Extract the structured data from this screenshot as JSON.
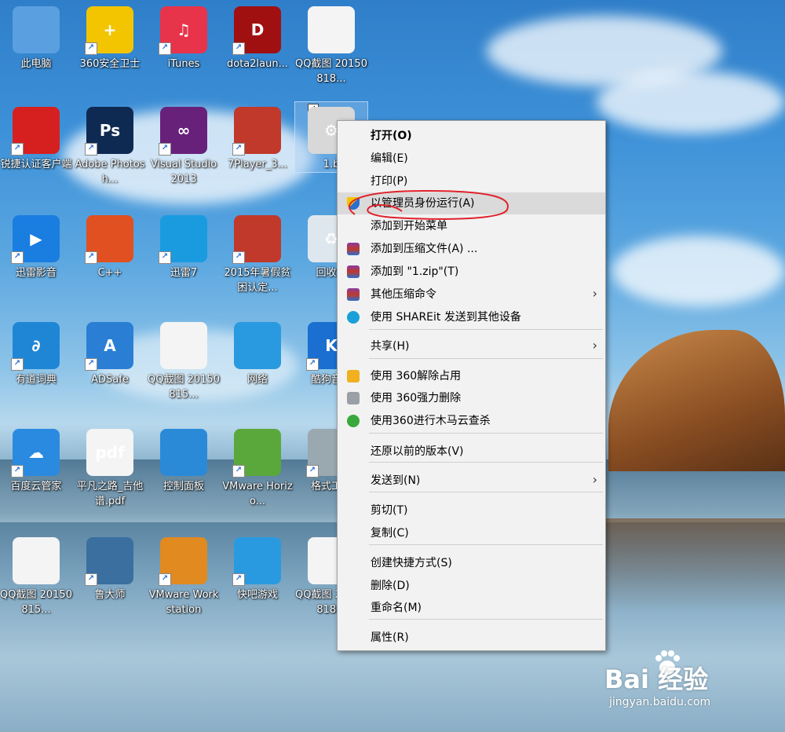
{
  "desktop": {
    "icons": [
      {
        "label": "此电脑",
        "symbol": "",
        "color": "#5aa0e0"
      },
      {
        "label": "360安全卫士",
        "symbol": "+",
        "color": "#f2c500"
      },
      {
        "label": "iTunes",
        "symbol": "♫",
        "color": "#e8344a"
      },
      {
        "label": "dota2laun...",
        "symbol": "D",
        "color": "#a01010"
      },
      {
        "label": "QQ截图 20150818...",
        "symbol": "",
        "color": "#f4f4f4"
      },
      {
        "label": "锐捷认证客户端",
        "symbol": "",
        "color": "#d62020"
      },
      {
        "label": "Adobe Photosh...",
        "symbol": "Ps",
        "color": "#0f2a52"
      },
      {
        "label": "Visual Studio 2013",
        "symbol": "∞",
        "color": "#68217a"
      },
      {
        "label": "7Player_3...",
        "symbol": "",
        "color": "#c0392b"
      },
      {
        "label": "1.b",
        "symbol": "⚙",
        "color": "#d8d8d8"
      },
      {
        "label": "迅雷影音",
        "symbol": "▶",
        "color": "#1a7de0"
      },
      {
        "label": "C++",
        "symbol": "",
        "color": "#e05020"
      },
      {
        "label": "迅雷7",
        "symbol": "",
        "color": "#1a9be0"
      },
      {
        "label": "2015年暑假贫困认定...",
        "symbol": "",
        "color": "#c0392b"
      },
      {
        "label": "回收站",
        "symbol": "♻",
        "color": "#dfe7ee"
      },
      {
        "label": "有道词典",
        "symbol": "∂",
        "color": "#1f86d6"
      },
      {
        "label": "ADSafe",
        "symbol": "A",
        "color": "#2a7fd4"
      },
      {
        "label": "QQ截图 20150815...",
        "symbol": "",
        "color": "#f4f4f4"
      },
      {
        "label": "网络",
        "symbol": "",
        "color": "#2a9ae0"
      },
      {
        "label": "酷狗音乐",
        "symbol": "K",
        "color": "#1a6fd0"
      },
      {
        "label": "百度云管家",
        "symbol": "☁",
        "color": "#2a8ae0"
      },
      {
        "label": "平凡之路_吉他谱.pdf",
        "symbol": "pdf",
        "color": "#f4f4f4"
      },
      {
        "label": "控制面板",
        "symbol": "",
        "color": "#2a8ad8"
      },
      {
        "label": "VMware Horizo...",
        "symbol": "",
        "color": "#5aa83c"
      },
      {
        "label": "格式工厂",
        "symbol": "",
        "color": "#9aa8b0"
      },
      {
        "label": "QQ截图 20150815...",
        "symbol": "",
        "color": "#f4f4f4"
      },
      {
        "label": "鲁大师",
        "symbol": "",
        "color": "#3a6fa0"
      },
      {
        "label": "VMware Workstation",
        "symbol": "",
        "color": "#e08a20"
      },
      {
        "label": "快吧游戏",
        "symbol": "",
        "color": "#2a9ae0"
      },
      {
        "label": "QQ截图 20150818...",
        "symbol": "",
        "color": "#f4f4f4"
      }
    ]
  },
  "context_menu": {
    "items": [
      {
        "label": "打开(O)",
        "icon": "",
        "submenu": false,
        "bold": true
      },
      {
        "label": "编辑(E)",
        "icon": "",
        "submenu": false
      },
      {
        "label": "打印(P)",
        "icon": "",
        "submenu": false
      },
      {
        "label": "以管理员身份运行(A)",
        "icon": "uac-shield-icon",
        "submenu": false,
        "highlighted": true
      },
      {
        "label": "添加到开始菜单",
        "icon": "",
        "submenu": false
      },
      {
        "label": "添加到压缩文件(A) ...",
        "icon": "winrar-icon",
        "submenu": false
      },
      {
        "label": "添加到 \"1.zip\"(T)",
        "icon": "winrar-icon",
        "submenu": false
      },
      {
        "label": "其他压缩命令",
        "icon": "winrar-icon",
        "submenu": true
      },
      {
        "label": "使用 SHAREit 发送到其他设备",
        "icon": "shareit-icon",
        "submenu": false
      },
      {
        "label": "共享(H)",
        "icon": "",
        "submenu": true
      },
      {
        "label": "使用 360解除占用",
        "icon": "unlock-360-icon",
        "submenu": false
      },
      {
        "label": "使用 360强力删除",
        "icon": "shred-360-icon",
        "submenu": false
      },
      {
        "label": "使用360进行木马云查杀",
        "icon": "scan-360-icon",
        "submenu": false
      },
      {
        "label": "还原以前的版本(V)",
        "icon": "",
        "submenu": false
      },
      {
        "label": "发送到(N)",
        "icon": "",
        "submenu": true
      },
      {
        "label": "剪切(T)",
        "icon": "",
        "submenu": false
      },
      {
        "label": "复制(C)",
        "icon": "",
        "submenu": false
      },
      {
        "label": "创建快捷方式(S)",
        "icon": "",
        "submenu": false
      },
      {
        "label": "删除(D)",
        "icon": "",
        "submenu": false
      },
      {
        "label": "重命名(M)",
        "icon": "",
        "submenu": false
      },
      {
        "label": "属性(R)",
        "icon": "",
        "submenu": false
      }
    ]
  },
  "watermark": {
    "brand": "Bai 经验",
    "url": "jingyan.baidu.com"
  },
  "colors": {
    "menu_bg": "#f2f2f2",
    "highlight": "#dadada",
    "annotation": "#e0202a"
  }
}
